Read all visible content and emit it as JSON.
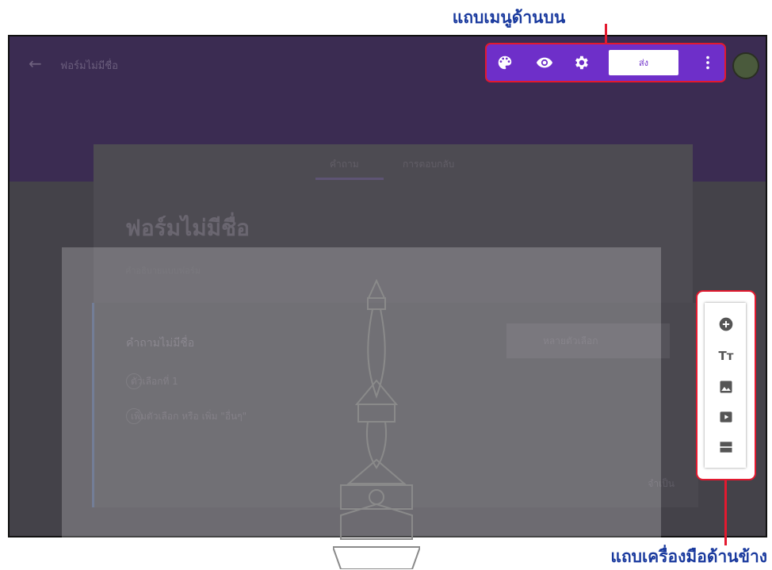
{
  "callouts": {
    "top_menu": "แถบเมนูด้านบน",
    "side_toolbar": "แถบเครื่องมือด้านข้าง"
  },
  "header": {
    "title": "ฟอร์มไม่มีชื่อ",
    "send_label": "ส่ง",
    "icons": [
      "palette-icon",
      "preview-icon",
      "settings-icon",
      "more-vert-icon"
    ]
  },
  "tabs": [
    {
      "label": "คำถาม"
    },
    {
      "label": "การตอบกลับ"
    }
  ],
  "form": {
    "title": "ฟอร์มไม่มีชื่อ",
    "description": "คำอธิบายแบบฟอร์ม"
  },
  "question": {
    "title": "คำถามไม่มีชื่อ",
    "type": "หลายตัวเลือก",
    "options": [
      "ตัวเลือกที่ 1"
    ],
    "add_option": "เพิ่มตัวเลือก หรือ เพิ่ม \"อื่นๆ\"",
    "required_label": "จำเป็น"
  },
  "side_toolbar": {
    "items": [
      "add-question-icon",
      "add-title-icon",
      "add-image-icon",
      "add-video-icon",
      "add-section-icon"
    ]
  },
  "colors": {
    "accent": "#6e2fc9",
    "highlight": "#e3192f",
    "callout_text": "#1a3a9e"
  }
}
